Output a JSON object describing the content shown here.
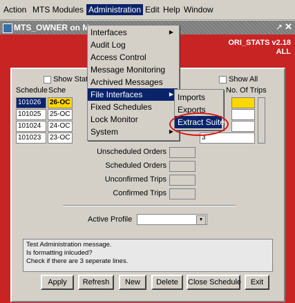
{
  "menubar": {
    "items": [
      "Action",
      "MTS Modules",
      "Administration",
      "Edit",
      "Help",
      "Window"
    ]
  },
  "window": {
    "title": "MTS_OWNER on M",
    "badge_line1": "ORI_STATS v2.18",
    "badge_line2": "ALL"
  },
  "admin_menu": {
    "items": [
      "Interfaces",
      "Audit Log",
      "Access Control",
      "Message Monitoring",
      "Archived Messages",
      "File Interfaces",
      "Fixed Schedules",
      "Lock Monitor",
      "System"
    ]
  },
  "file_interfaces_menu": {
    "items": [
      "Imports",
      "Exports",
      "Extract Suite"
    ]
  },
  "form": {
    "show_stats_label": "Show Stats",
    "show_all_label": "Show All",
    "col_schedule": "Schedule",
    "col_sched_date": "Sche",
    "col_no_trips": "No. Of Trips",
    "schedule_rows": [
      {
        "id": "101026",
        "date": "26-OC"
      },
      {
        "id": "101025",
        "date": "25-OC"
      },
      {
        "id": "101024",
        "date": "24-OC"
      },
      {
        "id": "101023",
        "date": "23-OC"
      }
    ],
    "trips_rows": [
      "",
      "",
      "",
      "3"
    ],
    "unscheduled_orders_label": "Unscheduled Orders",
    "scheduled_orders_label": "Scheduled Orders",
    "unconfirmed_trips_label": "Unconfirmed Trips",
    "confirmed_trips_label": "Confirmed Trips",
    "active_profile_label": "Active Profile",
    "message_lines": [
      "Test Administration message.",
      "Is formatting inlcuded?",
      "Check if there are 3 seperate lines."
    ]
  },
  "buttons": {
    "apply": "Apply",
    "refresh": "Refresh",
    "new": "New",
    "delete": "Delete",
    "close_schedule": "Close Schedule",
    "exit": "Exit"
  },
  "colors": {
    "window_bg": "#c82424",
    "highlight": "#0a246a",
    "annotation_ring": "#e01010",
    "selected_date_bg": "#ffd700"
  }
}
